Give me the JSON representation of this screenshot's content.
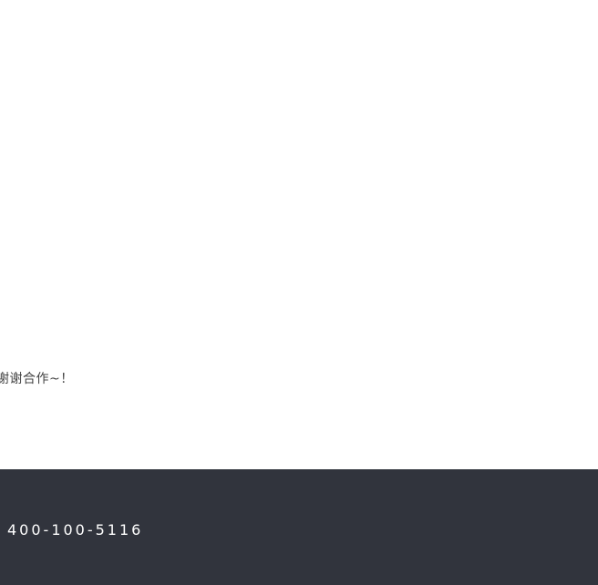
{
  "main": {
    "closing_text": "谢谢合作~！"
  },
  "footer": {
    "phone": "400-100-5116"
  }
}
